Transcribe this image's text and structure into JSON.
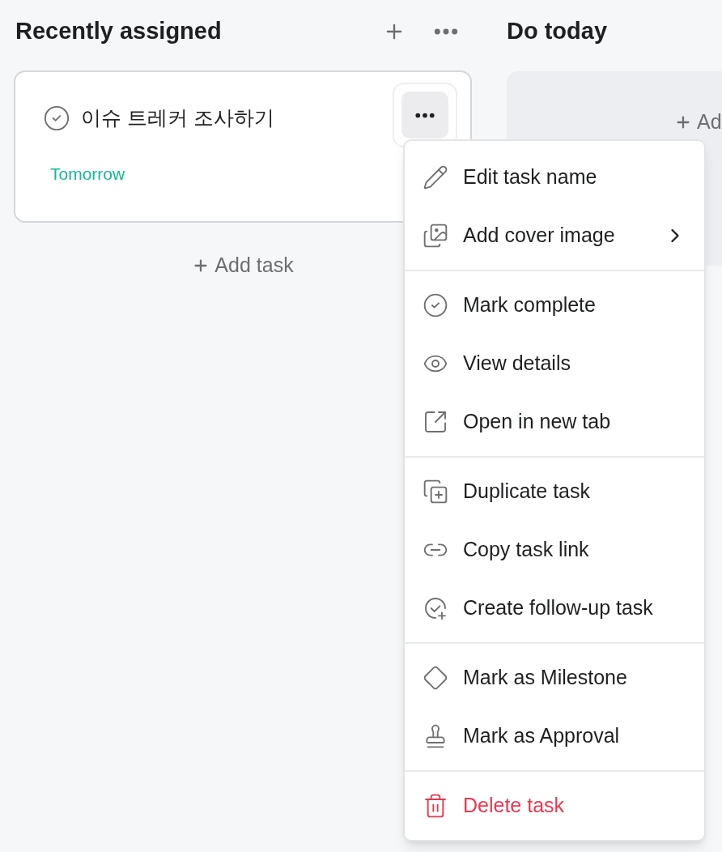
{
  "columns": [
    {
      "title": "Recently assigned",
      "cards": [
        {
          "title": "이슈 트레커 조사하기",
          "due": "Tomorrow",
          "completed": false
        }
      ],
      "add_task": "Add task"
    },
    {
      "title": "Do today",
      "add_task": "Ad"
    }
  ],
  "menu": {
    "sections": [
      {
        "items": [
          {
            "label": "Edit task name",
            "submenu": false,
            "danger": false
          },
          {
            "label": "Add cover image",
            "submenu": true,
            "danger": false
          }
        ]
      },
      {
        "items": [
          {
            "label": "Mark complete",
            "submenu": false,
            "danger": false
          },
          {
            "label": "View details",
            "submenu": false,
            "danger": false
          },
          {
            "label": "Open in new tab",
            "submenu": false,
            "danger": false
          }
        ]
      },
      {
        "items": [
          {
            "label": "Duplicate task",
            "submenu": false,
            "danger": false
          },
          {
            "label": "Copy task link",
            "submenu": false,
            "danger": false
          },
          {
            "label": "Create follow-up task",
            "submenu": false,
            "danger": false
          }
        ]
      },
      {
        "items": [
          {
            "label": "Mark as Milestone",
            "submenu": false,
            "danger": false
          },
          {
            "label": "Mark as Approval",
            "submenu": false,
            "danger": false
          }
        ]
      },
      {
        "items": [
          {
            "label": "Delete task",
            "submenu": false,
            "danger": true
          }
        ]
      }
    ]
  }
}
